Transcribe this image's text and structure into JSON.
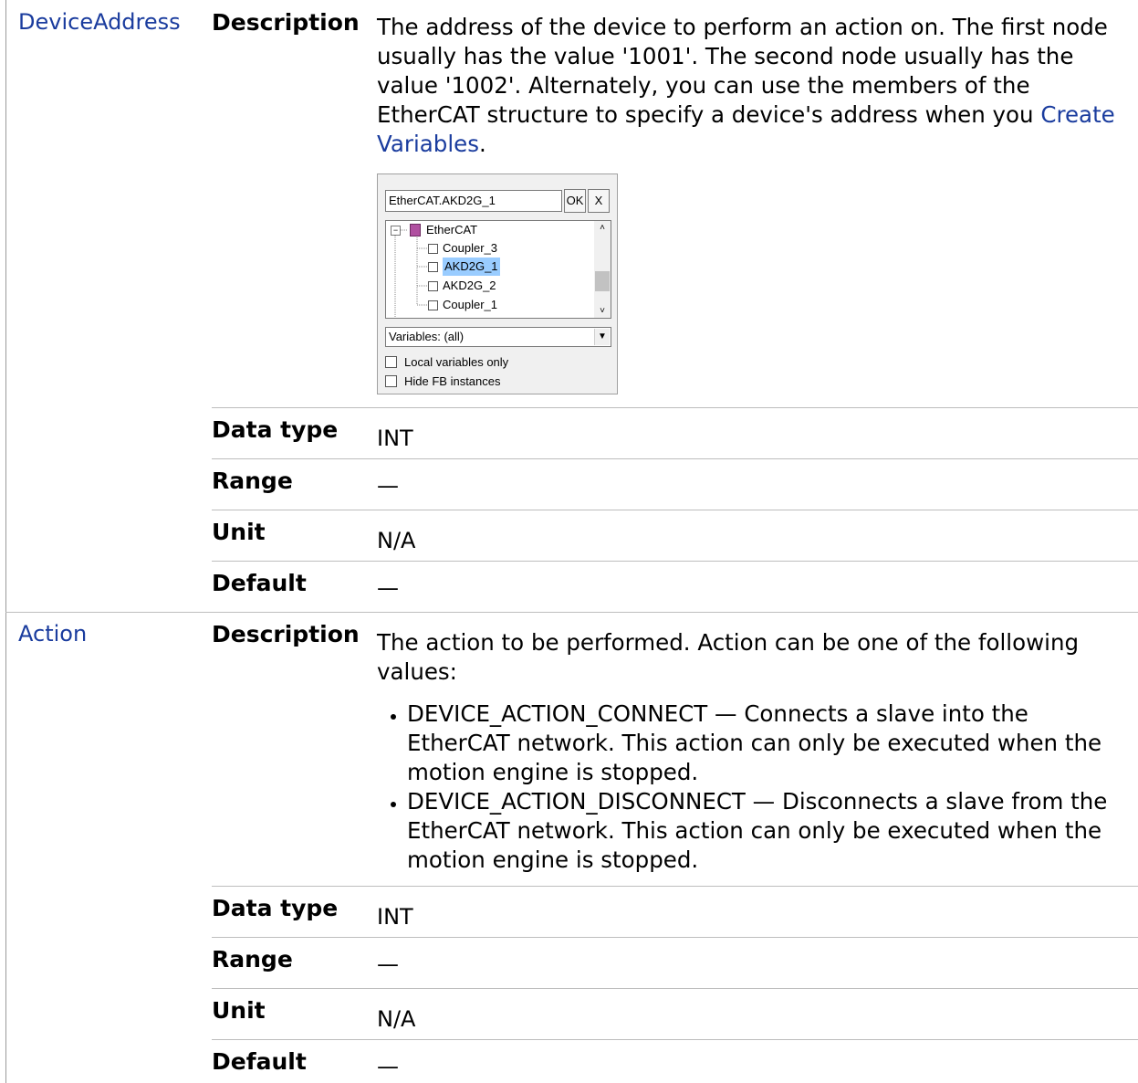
{
  "params": [
    {
      "name": "DeviceAddress",
      "description_label": "Description",
      "description_text_before": "The address of the device to perform an action on. The first node usually has the value '1001'. The second node usually has the value '1002'. Alternately, you can use the members of the EtherCAT structure to specify a device's address when you ",
      "description_link": "Create Variables",
      "description_text_after": ".",
      "dialog": {
        "field_value": "EtherCAT.AKD2G_1",
        "ok_label": "OK",
        "close_label": "X",
        "tree": [
          "EtherCAT",
          "Coupler_3",
          "AKD2G_1",
          "AKD2G_2",
          "Coupler_1"
        ],
        "selected": "AKD2G_1",
        "combo_value": "Variables: (all)",
        "check_local": "Local variables only",
        "check_hide": "Hide FB instances"
      },
      "rows": [
        {
          "label": "Data type",
          "value": "INT"
        },
        {
          "label": "Range",
          "value": "—"
        },
        {
          "label": "Unit",
          "value": "N/A"
        },
        {
          "label": "Default",
          "value": "—"
        }
      ]
    },
    {
      "name": "Action",
      "description_label": "Description",
      "description_text": "The action to be performed.  Action can be one of the following values:",
      "bullets": [
        "DEVICE_ACTION_CONNECT — Connects a slave into the EtherCAT network.  This action can only be executed when the motion engine is stopped.",
        "DEVICE_ACTION_DISCONNECT — Disconnects a slave from the EtherCAT network.  This action can only be executed when the motion engine is stopped."
      ],
      "rows": [
        {
          "label": "Data type",
          "value": "INT"
        },
        {
          "label": "Range",
          "value": "—"
        },
        {
          "label": "Unit",
          "value": "N/A"
        },
        {
          "label": "Default",
          "value": "—"
        }
      ]
    }
  ]
}
